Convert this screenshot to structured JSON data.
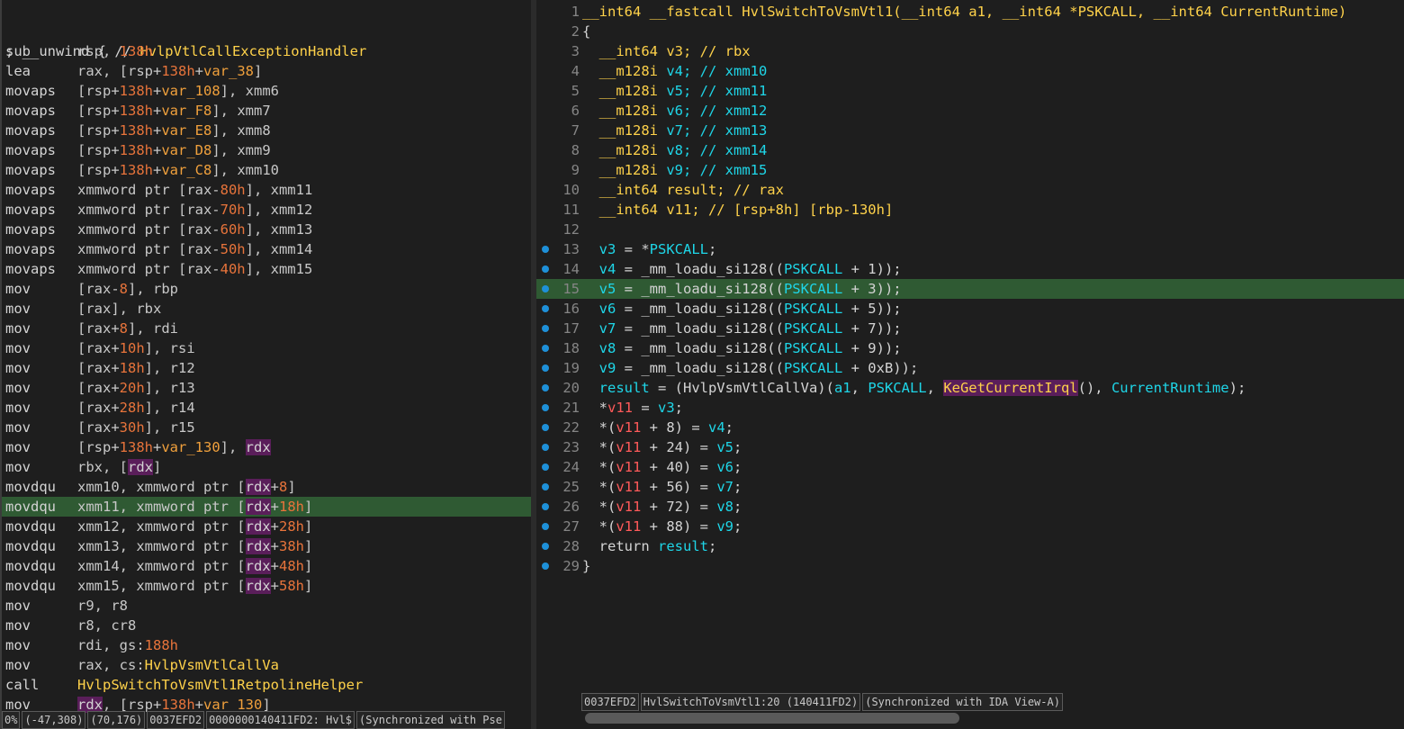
{
  "disasm": {
    "comment_line": "; __unwind { // HvlpVtlCallExceptionHandler",
    "lines": [
      {
        "m": "sub",
        "o": [
          [
            "r",
            "rsp, "
          ],
          [
            "n",
            "138h"
          ]
        ]
      },
      {
        "m": "lea",
        "o": [
          [
            "r",
            "rax, [rsp+"
          ],
          [
            "n",
            "138h"
          ],
          [
            "r",
            "+"
          ],
          [
            "v",
            "var_38"
          ],
          [
            "r",
            "]"
          ]
        ]
      },
      {
        "m": "movaps",
        "o": [
          [
            "r",
            "[rsp+"
          ],
          [
            "n",
            "138h"
          ],
          [
            "r",
            "+"
          ],
          [
            "v",
            "var_108"
          ],
          [
            "r",
            "], xmm6"
          ]
        ]
      },
      {
        "m": "movaps",
        "o": [
          [
            "r",
            "[rsp+"
          ],
          [
            "n",
            "138h"
          ],
          [
            "r",
            "+"
          ],
          [
            "v",
            "var_F8"
          ],
          [
            "r",
            "], xmm7"
          ]
        ]
      },
      {
        "m": "movaps",
        "o": [
          [
            "r",
            "[rsp+"
          ],
          [
            "n",
            "138h"
          ],
          [
            "r",
            "+"
          ],
          [
            "v",
            "var_E8"
          ],
          [
            "r",
            "], xmm8"
          ]
        ]
      },
      {
        "m": "movaps",
        "o": [
          [
            "r",
            "[rsp+"
          ],
          [
            "n",
            "138h"
          ],
          [
            "r",
            "+"
          ],
          [
            "v",
            "var_D8"
          ],
          [
            "r",
            "], xmm9"
          ]
        ]
      },
      {
        "m": "movaps",
        "o": [
          [
            "r",
            "[rsp+"
          ],
          [
            "n",
            "138h"
          ],
          [
            "r",
            "+"
          ],
          [
            "v",
            "var_C8"
          ],
          [
            "r",
            "], xmm10"
          ]
        ]
      },
      {
        "m": "movaps",
        "o": [
          [
            "r",
            "xmmword ptr [rax-"
          ],
          [
            "n",
            "80h"
          ],
          [
            "r",
            "], xmm11"
          ]
        ]
      },
      {
        "m": "movaps",
        "o": [
          [
            "r",
            "xmmword ptr [rax-"
          ],
          [
            "n",
            "70h"
          ],
          [
            "r",
            "], xmm12"
          ]
        ]
      },
      {
        "m": "movaps",
        "o": [
          [
            "r",
            "xmmword ptr [rax-"
          ],
          [
            "n",
            "60h"
          ],
          [
            "r",
            "], xmm13"
          ]
        ]
      },
      {
        "m": "movaps",
        "o": [
          [
            "r",
            "xmmword ptr [rax-"
          ],
          [
            "n",
            "50h"
          ],
          [
            "r",
            "], xmm14"
          ]
        ]
      },
      {
        "m": "movaps",
        "o": [
          [
            "r",
            "xmmword ptr [rax-"
          ],
          [
            "n",
            "40h"
          ],
          [
            "r",
            "], xmm15"
          ]
        ]
      },
      {
        "m": "mov",
        "o": [
          [
            "r",
            "[rax-"
          ],
          [
            "n",
            "8"
          ],
          [
            "r",
            "], rbp"
          ]
        ]
      },
      {
        "m": "mov",
        "o": [
          [
            "r",
            "[rax], rbx"
          ]
        ]
      },
      {
        "m": "mov",
        "o": [
          [
            "r",
            "[rax+"
          ],
          [
            "n",
            "8"
          ],
          [
            "r",
            "], rdi"
          ]
        ]
      },
      {
        "m": "mov",
        "o": [
          [
            "r",
            "[rax+"
          ],
          [
            "n",
            "10h"
          ],
          [
            "r",
            "], rsi"
          ]
        ]
      },
      {
        "m": "mov",
        "o": [
          [
            "r",
            "[rax+"
          ],
          [
            "n",
            "18h"
          ],
          [
            "r",
            "], r12"
          ]
        ]
      },
      {
        "m": "mov",
        "o": [
          [
            "r",
            "[rax+"
          ],
          [
            "n",
            "20h"
          ],
          [
            "r",
            "], r13"
          ]
        ]
      },
      {
        "m": "mov",
        "o": [
          [
            "r",
            "[rax+"
          ],
          [
            "n",
            "28h"
          ],
          [
            "r",
            "], r14"
          ]
        ]
      },
      {
        "m": "mov",
        "o": [
          [
            "r",
            "[rax+"
          ],
          [
            "n",
            "30h"
          ],
          [
            "r",
            "], r15"
          ]
        ]
      },
      {
        "m": "mov",
        "o": [
          [
            "r",
            "[rsp+"
          ],
          [
            "n",
            "138h"
          ],
          [
            "r",
            "+"
          ],
          [
            "v",
            "var_130"
          ],
          [
            "r",
            "], "
          ],
          [
            "s",
            "rdx"
          ]
        ]
      },
      {
        "m": "mov",
        "o": [
          [
            "r",
            "rbx, ["
          ],
          [
            "s",
            "rdx"
          ],
          [
            "r",
            "]"
          ]
        ]
      },
      {
        "m": "movdqu",
        "o": [
          [
            "r",
            "xmm10, xmmword ptr ["
          ],
          [
            "s",
            "rdx"
          ],
          [
            "r",
            "+"
          ],
          [
            "n",
            "8"
          ],
          [
            "r",
            "]"
          ]
        ]
      },
      {
        "m": "movdqu",
        "hl": true,
        "o": [
          [
            "r",
            "xmm11, xmmword ptr ["
          ],
          [
            "s",
            "rdx"
          ],
          [
            "r",
            "+"
          ],
          [
            "n",
            "18h"
          ],
          [
            "r",
            "]"
          ]
        ]
      },
      {
        "m": "movdqu",
        "o": [
          [
            "r",
            "xmm12, xmmword ptr ["
          ],
          [
            "s",
            "rdx"
          ],
          [
            "r",
            "+"
          ],
          [
            "n",
            "28h"
          ],
          [
            "r",
            "]"
          ]
        ]
      },
      {
        "m": "movdqu",
        "o": [
          [
            "r",
            "xmm13, xmmword ptr ["
          ],
          [
            "s",
            "rdx"
          ],
          [
            "r",
            "+"
          ],
          [
            "n",
            "38h"
          ],
          [
            "r",
            "]"
          ]
        ]
      },
      {
        "m": "movdqu",
        "o": [
          [
            "r",
            "xmm14, xmmword ptr ["
          ],
          [
            "s",
            "rdx"
          ],
          [
            "r",
            "+"
          ],
          [
            "n",
            "48h"
          ],
          [
            "r",
            "]"
          ]
        ]
      },
      {
        "m": "movdqu",
        "o": [
          [
            "r",
            "xmm15, xmmword ptr ["
          ],
          [
            "s",
            "rdx"
          ],
          [
            "r",
            "+"
          ],
          [
            "n",
            "58h"
          ],
          [
            "r",
            "]"
          ]
        ]
      },
      {
        "m": "mov",
        "o": [
          [
            "r",
            "r9, r8"
          ]
        ]
      },
      {
        "m": "mov",
        "o": [
          [
            "r",
            "r8, cr8"
          ]
        ]
      },
      {
        "m": "mov",
        "o": [
          [
            "r",
            "rdi, gs:"
          ],
          [
            "n",
            "188h"
          ]
        ]
      },
      {
        "m": "mov",
        "o": [
          [
            "r",
            "rax, cs:"
          ],
          [
            "y",
            "HvlpVsmVtlCallVa"
          ]
        ]
      },
      {
        "m": "call",
        "o": [
          [
            "y",
            "HvlpSwitchToVsmVtl1RetpolineHelper"
          ]
        ]
      },
      {
        "m": "mov",
        "o": [
          [
            "s",
            "rdx"
          ],
          [
            "r",
            ", [rsp+"
          ],
          [
            "n",
            "138h"
          ],
          [
            "r",
            "+"
          ],
          [
            "v",
            "var_130"
          ],
          [
            "r",
            "]"
          ]
        ]
      }
    ],
    "status": [
      "0%",
      "(-47,308)",
      "(70,176)",
      "0037EFD2",
      "0000000140411FD2: Hvl$",
      "(Synchronized with Pse"
    ]
  },
  "pseudo": {
    "lines": [
      {
        "n": "1",
        "t": [
          [
            "k",
            "__int64 __fastcall HvlSwitchToVsmVtl1(__int64 a1, __int64 *PSKCALL, __int64 CurrentRuntime)"
          ]
        ]
      },
      {
        "n": "2",
        "t": [
          [
            "p",
            "{"
          ]
        ]
      },
      {
        "n": "3",
        "t": [
          [
            "k",
            "  __int64 v3; // rbx"
          ]
        ]
      },
      {
        "n": "4",
        "t": [
          [
            "k",
            "  __m128i "
          ],
          [
            "c",
            "v4; // xmm10"
          ]
        ]
      },
      {
        "n": "5",
        "t": [
          [
            "k",
            "  __m128i "
          ],
          [
            "c",
            "v5; // xmm11"
          ]
        ]
      },
      {
        "n": "6",
        "t": [
          [
            "k",
            "  __m128i "
          ],
          [
            "c",
            "v6; // xmm12"
          ]
        ]
      },
      {
        "n": "7",
        "t": [
          [
            "k",
            "  __m128i "
          ],
          [
            "c",
            "v7; // xmm13"
          ]
        ]
      },
      {
        "n": "8",
        "t": [
          [
            "k",
            "  __m128i "
          ],
          [
            "c",
            "v8; // xmm14"
          ]
        ]
      },
      {
        "n": "9",
        "t": [
          [
            "k",
            "  __m128i "
          ],
          [
            "c",
            "v9; // xmm15"
          ]
        ]
      },
      {
        "n": "10",
        "t": [
          [
            "k",
            "  __int64 result; // rax"
          ]
        ]
      },
      {
        "n": "11",
        "t": [
          [
            "k",
            "  __int64 v11; // [rsp+8h] [rbp-130h]"
          ]
        ]
      },
      {
        "n": "12",
        "t": [
          [
            "p",
            ""
          ]
        ]
      },
      {
        "n": "13",
        "dot": true,
        "t": [
          [
            "c",
            "  v3"
          ],
          [
            "p",
            " = *"
          ],
          [
            "c",
            "PSKCALL"
          ],
          [
            "p",
            ";"
          ]
        ]
      },
      {
        "n": "14",
        "dot": true,
        "t": [
          [
            "c",
            "  v4"
          ],
          [
            "p",
            " = _mm_loadu_si128(("
          ],
          [
            "c",
            "PSKCALL"
          ],
          [
            "p",
            " + 1));"
          ]
        ]
      },
      {
        "n": "15",
        "dot": true,
        "hl": true,
        "t": [
          [
            "c",
            "  v5"
          ],
          [
            "p",
            " = _mm_loadu_si128(("
          ],
          [
            "c",
            "PSKCALL"
          ],
          [
            "p",
            " + 3));"
          ]
        ]
      },
      {
        "n": "16",
        "dot": true,
        "t": [
          [
            "c",
            "  v6"
          ],
          [
            "p",
            " = _mm_loadu_si128(("
          ],
          [
            "c",
            "PSKCALL"
          ],
          [
            "p",
            " + 5));"
          ]
        ]
      },
      {
        "n": "17",
        "dot": true,
        "t": [
          [
            "c",
            "  v7"
          ],
          [
            "p",
            " = _mm_loadu_si128(("
          ],
          [
            "c",
            "PSKCALL"
          ],
          [
            "p",
            " + 7));"
          ]
        ]
      },
      {
        "n": "18",
        "dot": true,
        "t": [
          [
            "c",
            "  v8"
          ],
          [
            "p",
            " = _mm_loadu_si128(("
          ],
          [
            "c",
            "PSKCALL"
          ],
          [
            "p",
            " + 9));"
          ]
        ]
      },
      {
        "n": "19",
        "dot": true,
        "t": [
          [
            "c",
            "  v9"
          ],
          [
            "p",
            " = _mm_loadu_si128(("
          ],
          [
            "c",
            "PSKCALL"
          ],
          [
            "p",
            " + 0xB));"
          ]
        ]
      },
      {
        "n": "20",
        "dot": true,
        "t": [
          [
            "c",
            "  result"
          ],
          [
            "p",
            " = (HvlpVsmVtlCallVa)("
          ],
          [
            "c",
            "a1"
          ],
          [
            "p",
            ", "
          ],
          [
            "c",
            "PSKCALL"
          ],
          [
            "p",
            ", "
          ],
          [
            "s",
            "KeGetCurrentIrql"
          ],
          [
            "p",
            "(), "
          ],
          [
            "c",
            "CurrentRuntime"
          ],
          [
            "p",
            ");"
          ]
        ]
      },
      {
        "n": "21",
        "dot": true,
        "t": [
          [
            "p",
            "  *"
          ],
          [
            "rr",
            "v11"
          ],
          [
            "p",
            " = "
          ],
          [
            "c",
            "v3"
          ],
          [
            "p",
            ";"
          ]
        ]
      },
      {
        "n": "22",
        "dot": true,
        "t": [
          [
            "p",
            "  *("
          ],
          [
            "rr",
            "v11"
          ],
          [
            "p",
            " + 8) = "
          ],
          [
            "c",
            "v4"
          ],
          [
            "p",
            ";"
          ]
        ]
      },
      {
        "n": "23",
        "dot": true,
        "t": [
          [
            "p",
            "  *("
          ],
          [
            "rr",
            "v11"
          ],
          [
            "p",
            " + 24) = "
          ],
          [
            "c",
            "v5"
          ],
          [
            "p",
            ";"
          ]
        ]
      },
      {
        "n": "24",
        "dot": true,
        "t": [
          [
            "p",
            "  *("
          ],
          [
            "rr",
            "v11"
          ],
          [
            "p",
            " + 40) = "
          ],
          [
            "c",
            "v6"
          ],
          [
            "p",
            ";"
          ]
        ]
      },
      {
        "n": "25",
        "dot": true,
        "t": [
          [
            "p",
            "  *("
          ],
          [
            "rr",
            "v11"
          ],
          [
            "p",
            " + 56) = "
          ],
          [
            "c",
            "v7"
          ],
          [
            "p",
            ";"
          ]
        ]
      },
      {
        "n": "26",
        "dot": true,
        "t": [
          [
            "p",
            "  *("
          ],
          [
            "rr",
            "v11"
          ],
          [
            "p",
            " + 72) = "
          ],
          [
            "c",
            "v8"
          ],
          [
            "p",
            ";"
          ]
        ]
      },
      {
        "n": "27",
        "dot": true,
        "t": [
          [
            "p",
            "  *("
          ],
          [
            "rr",
            "v11"
          ],
          [
            "p",
            " + 88) = "
          ],
          [
            "c",
            "v9"
          ],
          [
            "p",
            ";"
          ]
        ]
      },
      {
        "n": "28",
        "dot": true,
        "t": [
          [
            "p",
            "  return "
          ],
          [
            "c",
            "result"
          ],
          [
            "p",
            ";"
          ]
        ]
      },
      {
        "n": "29",
        "dot": true,
        "t": [
          [
            "p",
            "}"
          ]
        ]
      }
    ],
    "status": [
      "0037EFD2",
      "HvlSwitchToVsmVtl1:20 (140411FD2)",
      "(Synchronized with IDA View-A)"
    ]
  }
}
